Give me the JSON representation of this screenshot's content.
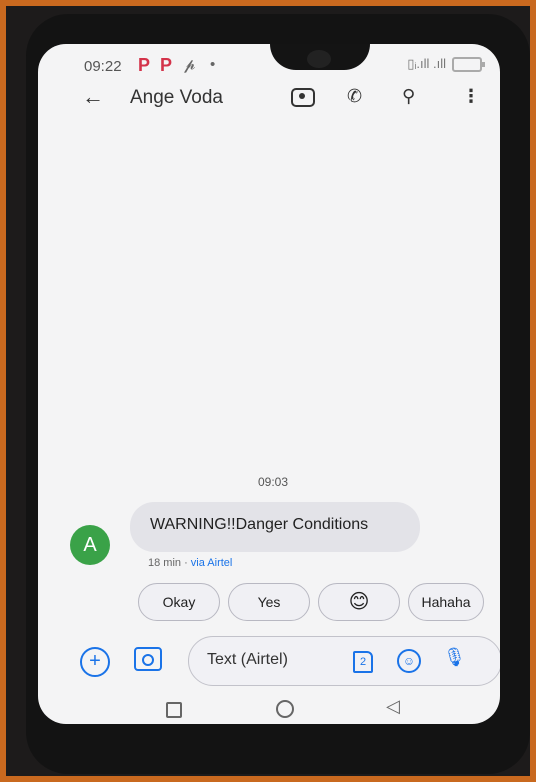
{
  "status_bar": {
    "time": "09:22",
    "notif_icons": [
      "P",
      "P",
      "𝓹",
      "•"
    ],
    "signal": "▯ᵢ.ıll .ıll"
  },
  "app_bar": {
    "contact_name": "Ange Voda"
  },
  "conversation": {
    "timestamp": "09:03",
    "avatar_letter": "A",
    "avatar_color": "#3aa248",
    "message_text": "WARNING!!Danger Conditions",
    "meta_time": "18 min · ",
    "meta_carrier": "via Airtel"
  },
  "smart_replies": [
    "Okay",
    "Yes",
    "😊",
    "Hahaha"
  ],
  "compose": {
    "placeholder": "Text (Airtel)",
    "sim_number": "2"
  },
  "colors": {
    "accent": "#1a73e8",
    "frame": "#c9691f"
  }
}
